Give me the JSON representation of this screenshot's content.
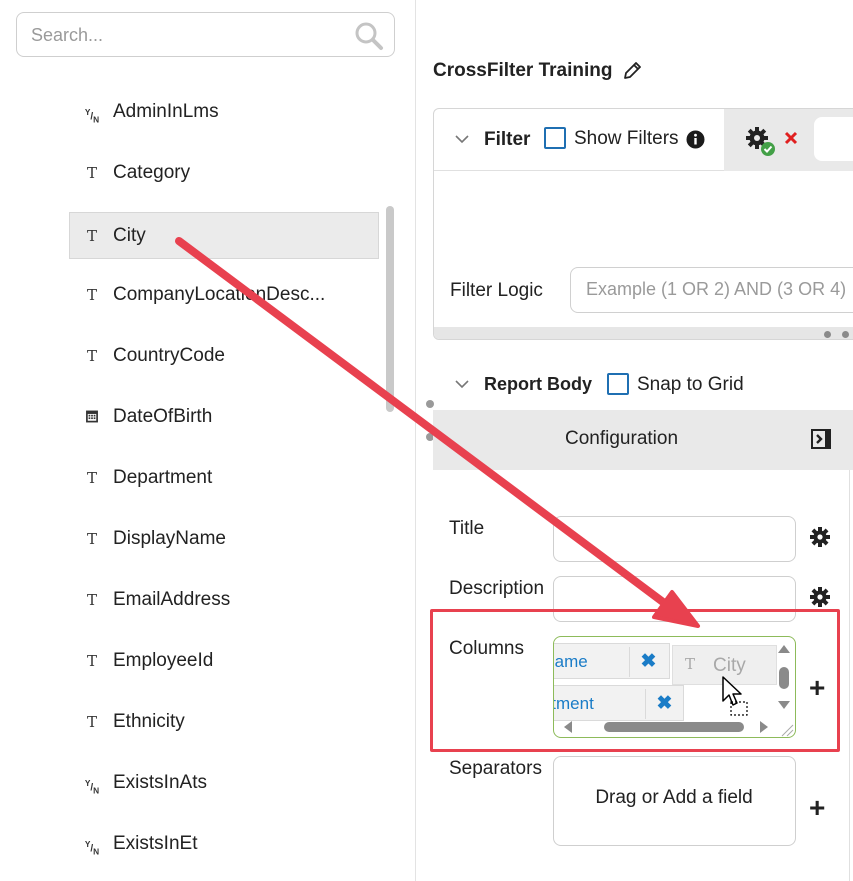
{
  "search": {
    "placeholder": "Search..."
  },
  "fields": [
    {
      "label": "AdminInLms",
      "type_icon": "Y/N",
      "icon_name": "boolean-icon"
    },
    {
      "label": "Category",
      "type_icon": "T",
      "icon_name": "text-type-icon"
    },
    {
      "label": "City",
      "type_icon": "T",
      "icon_name": "text-type-icon",
      "selected": true
    },
    {
      "label": "CompanyLocationDesc...",
      "type_icon": "T",
      "icon_name": "text-type-icon"
    },
    {
      "label": "CountryCode",
      "type_icon": "T",
      "icon_name": "text-type-icon"
    },
    {
      "label": "DateOfBirth",
      "type_icon": "calendar",
      "icon_name": "calendar-icon"
    },
    {
      "label": "Department",
      "type_icon": "T",
      "icon_name": "text-type-icon"
    },
    {
      "label": "DisplayName",
      "type_icon": "T",
      "icon_name": "text-type-icon"
    },
    {
      "label": "EmailAddress",
      "type_icon": "T",
      "icon_name": "text-type-icon"
    },
    {
      "label": "EmployeeId",
      "type_icon": "T",
      "icon_name": "text-type-icon"
    },
    {
      "label": "Ethnicity",
      "type_icon": "T",
      "icon_name": "text-type-icon"
    },
    {
      "label": "ExistsInAts",
      "type_icon": "Y/N",
      "icon_name": "boolean-icon"
    },
    {
      "label": "ExistsInEt",
      "type_icon": "Y/N",
      "icon_name": "boolean-icon"
    }
  ],
  "report": {
    "title": "CrossFilter Training",
    "filter": {
      "label": "Filter",
      "show_filters_label": "Show Filters",
      "logic_label": "Filter Logic",
      "logic_placeholder": "Example (1 OR 2) AND (3 OR 4)"
    },
    "body": {
      "label": "Report Body",
      "snap_label": "Snap to Grid"
    },
    "configuration": {
      "label": "Configuration",
      "title_label": "Title",
      "description_label": "Description",
      "columns_label": "Columns",
      "columns": [
        "FullName",
        "Department"
      ],
      "dragging_field": "City",
      "separators_label": "Separators",
      "separators_placeholder": "Drag or Add a field"
    }
  },
  "colors": {
    "accent_blue": "#1a7cc7",
    "annotation_red": "#e8414f",
    "drop_zone_green": "#8dbb5a",
    "delete_red": "#e02020",
    "check_green": "#43a047"
  }
}
